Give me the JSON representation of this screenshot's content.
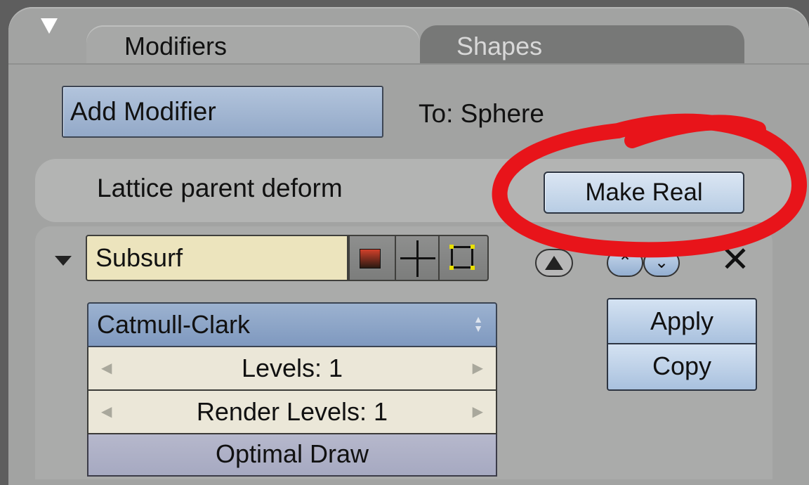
{
  "tabs": {
    "active": "Modifiers",
    "modifiers_label": "Modifiers",
    "shapes_label": "Shapes"
  },
  "header": {
    "add_modifier_label": "Add Modifier",
    "target_label": "To: Sphere"
  },
  "parent_deform": {
    "label": "Lattice parent deform",
    "make_real_label": "Make Real"
  },
  "modifier": {
    "name": "Subsurf",
    "subdivision_type": "Catmull-Clark",
    "levels_label": "Levels: 1",
    "render_levels_label": "Render Levels: 1",
    "optimal_draw_label": "Optimal Draw",
    "apply_label": "Apply",
    "copy_label": "Copy",
    "delete_glyph": "✕",
    "up_glyph": "⌃",
    "down_glyph": "⌄"
  },
  "icons": {
    "panel_collapse": "triangle-down-icon",
    "modifier_expand": "triangle-down-icon",
    "render_toggle": "render-picture-icon",
    "editmode_toggle": "crosshair-icon",
    "cage_toggle": "cage-square-icon",
    "on_cage": "cage-triangle-icon",
    "move_up": "chevron-up-icon",
    "move_down": "chevron-down-icon",
    "delete": "close-icon"
  },
  "colors": {
    "annotation": "#e8141a",
    "button_blue": "#93a9c8",
    "name_field": "#ece4bd"
  }
}
